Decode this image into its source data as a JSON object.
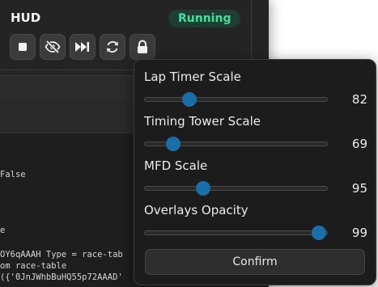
{
  "hud": {
    "title": "HUD",
    "status": "Running",
    "status_color": "#3ee39b",
    "toolbar": [
      {
        "icon": "stop-icon"
      },
      {
        "icon": "eye-off-icon"
      },
      {
        "icon": "skip-forward-icon"
      },
      {
        "icon": "refresh-icon"
      },
      {
        "icon": "lock-icon"
      }
    ]
  },
  "console": {
    "lines": [
      "False",
      "e",
      "OY6qAAAH Type = race-tab",
      "om race-table",
      "({'0JnJWhbBuHQ55p72AAAD'"
    ]
  },
  "popup": {
    "settings": [
      {
        "label": "Lap Timer Scale",
        "value": "82",
        "level": 0.245
      },
      {
        "label": "Timing Tower Scale",
        "value": "69",
        "level": 0.155
      },
      {
        "label": "MFD Scale",
        "value": "95",
        "level": 0.32
      },
      {
        "label": "Overlays Opacity",
        "value": "99",
        "level": 0.955
      }
    ],
    "confirm_label": "Confirm"
  },
  "colors": {
    "accent": "#1a6fa8",
    "panel": "#1c1c1c"
  }
}
